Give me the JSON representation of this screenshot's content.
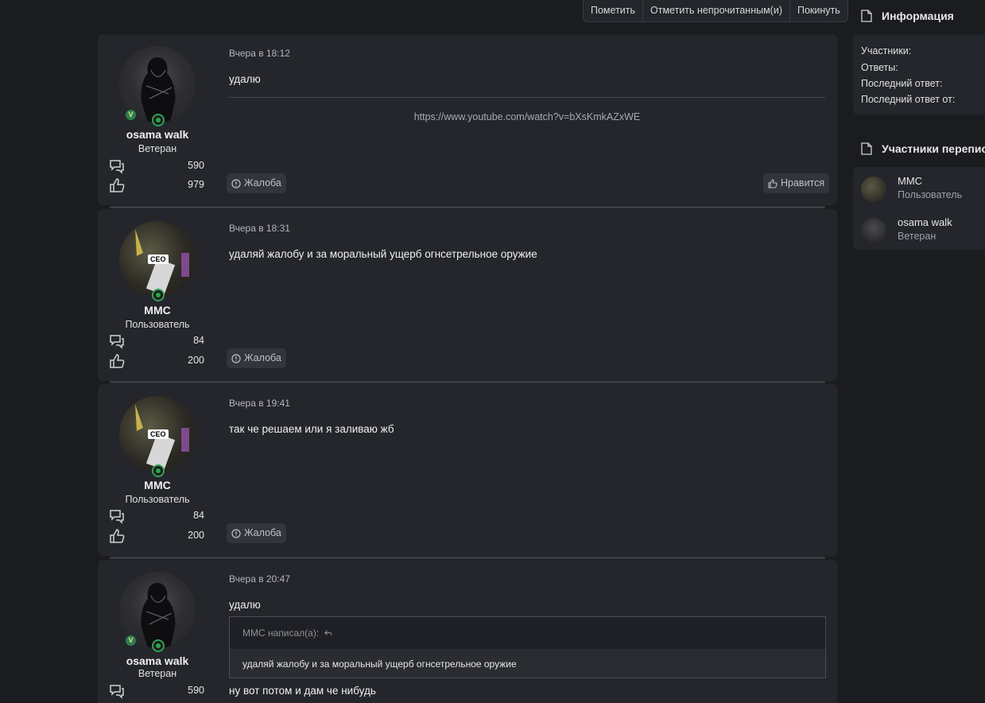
{
  "topbar": {
    "mark": "Пометить",
    "mark_unread": "Отметить непрочитанным(и)",
    "leave": "Покинуть"
  },
  "posts": [
    {
      "author": "osama walk",
      "user_title": "Ветеран",
      "messages_count": "590",
      "likes_count": "979",
      "time": "Вчера в 18:12",
      "text": "удалю",
      "signature_link": "https://www.youtube.com/watch?v=bXsKmkAZxWE",
      "report_label": "Жалоба",
      "like_label": "Нравится"
    },
    {
      "author": "MMC",
      "user_title": "Пользователь",
      "messages_count": "84",
      "likes_count": "200",
      "time": "Вчера в 18:31",
      "text": "удаляй жалобу и за моральный ущерб огнсетрельное оружие",
      "report_label": "Жалоба",
      "avatar_badge": "CEO"
    },
    {
      "author": "MMC",
      "user_title": "Пользователь",
      "messages_count": "84",
      "likes_count": "200",
      "time": "Вчера в 19:41",
      "text": "так че решаем или я заливаю жб",
      "report_label": "Жалоба",
      "avatar_badge": "CEO"
    },
    {
      "author": "osama walk",
      "user_title": "Ветеран",
      "messages_count": "590",
      "time": "Вчера в 20:47",
      "text": "удалю",
      "quote_header": "MMC написал(а):",
      "quote_text": "удаляй жалобу и за моральный ущерб огнсетрельное оружие",
      "text_after": "ну вот потом и дам че нибудь"
    }
  ],
  "sidebar": {
    "info_title": "Информация",
    "info_rows": [
      "Участники:",
      "Ответы:",
      "Последний ответ:",
      "Последний ответ от:"
    ],
    "members_title": "Участники переписки",
    "members": [
      {
        "name": "MMC",
        "title": "Пользователь"
      },
      {
        "name": "osama walk",
        "title": "Ветеран"
      }
    ]
  },
  "colors": {
    "background": "#1b1c20",
    "panel": "#24262c",
    "online_status": "#2ea44f"
  }
}
